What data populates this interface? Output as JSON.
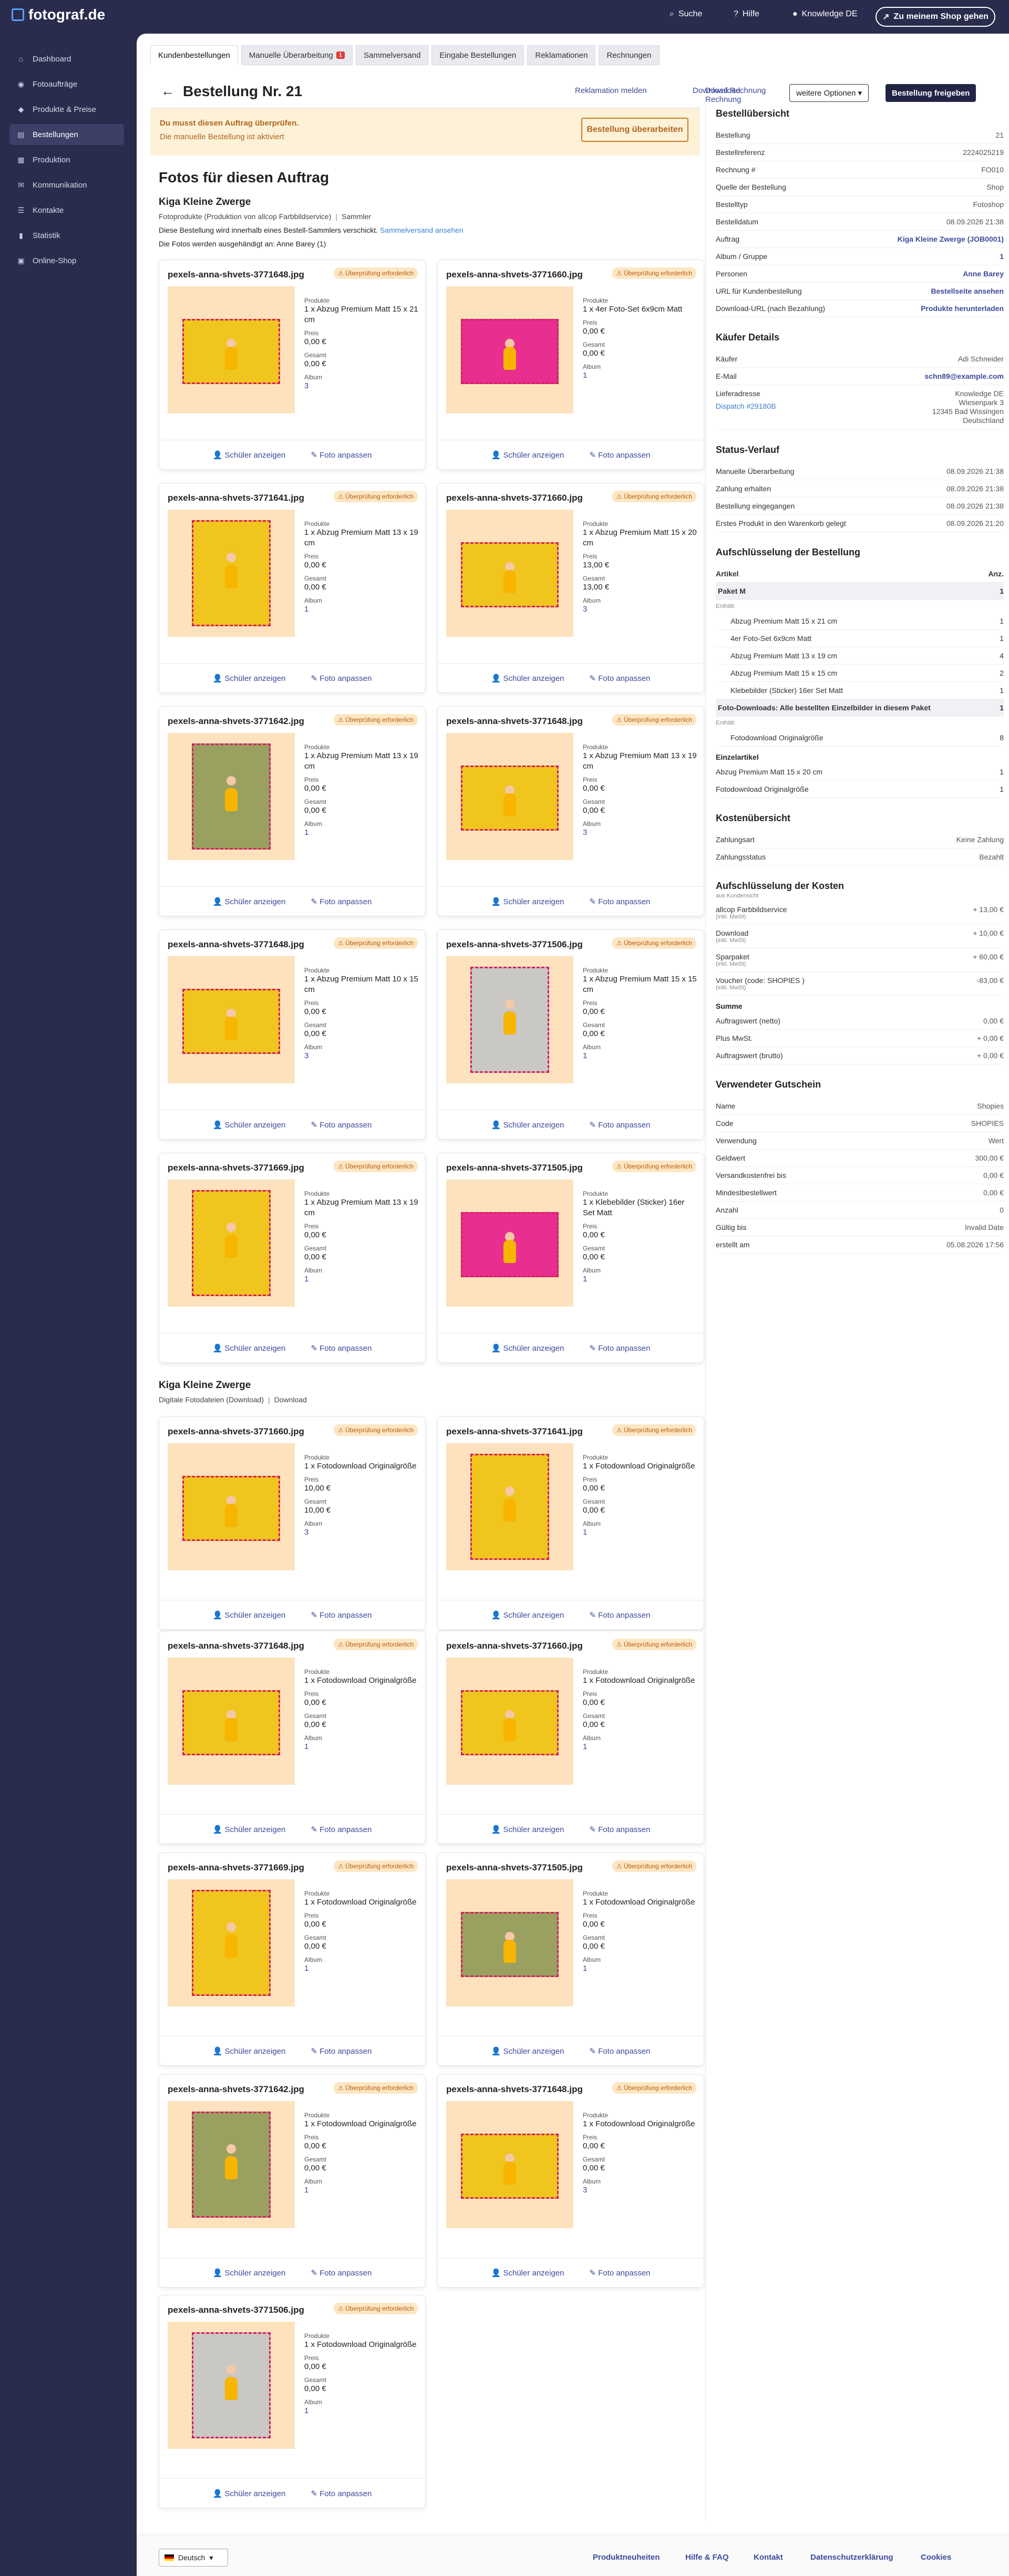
{
  "app": {
    "logo": "fotograf.de"
  },
  "sidebar": {
    "items": [
      {
        "label": "Dashboard",
        "icon": "home-icon",
        "glyph": "⌂"
      },
      {
        "label": "Fotoaufträge",
        "icon": "camera-icon",
        "glyph": "◉"
      },
      {
        "label": "Produkte & Preise",
        "icon": "tag-icon",
        "glyph": "◆"
      },
      {
        "label": "Bestellungen",
        "icon": "cart-icon",
        "glyph": "▤"
      },
      {
        "label": "Produktion",
        "icon": "factory-icon",
        "glyph": "▦"
      },
      {
        "label": "Kommunikation",
        "icon": "envelope-icon",
        "glyph": "✉"
      },
      {
        "label": "Kontakte",
        "icon": "contacts-icon",
        "glyph": "☰"
      },
      {
        "label": "Statistik",
        "icon": "chart-icon",
        "glyph": "▮"
      },
      {
        "label": "Online-Shop",
        "icon": "shop-icon",
        "glyph": "▣"
      }
    ]
  },
  "topbar": {
    "search": "Suche",
    "help": "Hilfe",
    "knowledge": "Knowledge DE",
    "shop_button": "Zu meinem Shop gehen"
  },
  "tabs": [
    {
      "label": "Kundenbestellungen"
    },
    {
      "label": "Manuelle Überarbeitung",
      "badge": "1"
    },
    {
      "label": "Sammelversand"
    },
    {
      "label": "Eingabe Bestellungen"
    },
    {
      "label": "Reklamationen"
    },
    {
      "label": "Rechnungen"
    }
  ],
  "header": {
    "title": "Bestellung Nr. 21",
    "reklamation": "Reklamation melden",
    "download": "Download Rechnung",
    "options": "weitere Optionen ▾",
    "release": "Bestellung freigeben"
  },
  "warning": {
    "title": "Du musst diesen Auftrag überprüfen.",
    "subtitle": "Die manuelle Bestellung ist aktiviert",
    "button": "Bestellung überarbeiten"
  },
  "main": {
    "section_title": "Fotos für diesen Auftrag",
    "group1": {
      "title": "Kiga Kleine Zwerge",
      "meta": "Fotoprodukte (Produktion von allcop Farbbildservice)",
      "meta2": "Sammler",
      "note": "Diese Bestellung wird innerhalb eines Bestell-Sammlers verschickt.",
      "note_link": "Sammelversand ansehen",
      "assigned": "Die Fotos werden ausgehändigt an: Anne Barey (1)"
    },
    "group2": {
      "title": "Kiga Kleine Zwerge",
      "meta": "Digitale Fotodateien (Download)",
      "meta2": "Download"
    }
  },
  "labels": {
    "produkte": "Produkte",
    "preis": "Preis",
    "gesamt": "Gesamt",
    "album": "Album",
    "badge": "⚠ Überprüfung erforderlich",
    "schueler": "Schüler anzeigen",
    "anpassen": "Foto anpassen"
  },
  "cards": [
    {
      "name": "pexels-anna-shvets-3771648.jpg",
      "product": "1 x Abzug Premium Matt 15 x 21 cm",
      "price": "0,00 €",
      "total": "0,00 €",
      "album": "3"
    },
    {
      "name": "pexels-anna-shvets-3771660.jpg",
      "product": "1 x 4er Foto-Set 6x9cm Matt",
      "price": "0,00 €",
      "total": "0,00 €",
      "album": "1"
    },
    {
      "name": "pexels-anna-shvets-3771641.jpg",
      "product": "1 x Abzug Premium Matt 13 x 19 cm",
      "price": "0,00 €",
      "total": "0,00 €",
      "album": "1"
    },
    {
      "name": "pexels-anna-shvets-3771660.jpg",
      "product": "1 x Abzug Premium Matt 15 x 20 cm",
      "price": "13,00 €",
      "total": "13,00 €",
      "album": "3"
    },
    {
      "name": "pexels-anna-shvets-3771642.jpg",
      "product": "1 x Abzug Premium Matt 13 x 19 cm",
      "price": "0,00 €",
      "total": "0,00 €",
      "album": "1"
    },
    {
      "name": "pexels-anna-shvets-3771648.jpg",
      "product": "1 x Abzug Premium Matt 13 x 19 cm",
      "price": "0,00 €",
      "total": "0,00 €",
      "album": "3"
    },
    {
      "name": "pexels-anna-shvets-3771648.jpg",
      "product": "1 x Abzug Premium Matt 10 x 15 cm",
      "price": "0,00 €",
      "total": "0,00 €",
      "album": "3"
    },
    {
      "name": "pexels-anna-shvets-3771506.jpg",
      "product": "1 x Abzug Premium Matt 15 x 15 cm",
      "price": "0,00 €",
      "total": "0,00 €",
      "album": "1"
    },
    {
      "name": "pexels-anna-shvets-3771669.jpg",
      "product": "1 x Abzug Premium Matt 13 x 19 cm",
      "price": "0,00 €",
      "total": "0,00 €",
      "album": "1"
    },
    {
      "name": "pexels-anna-shvets-3771505.jpg",
      "product": "1 x Klebebilder (Sticker) 16er Set Matt",
      "price": "0,00 €",
      "total": "0,00 €",
      "album": "1"
    },
    {
      "name": "pexels-anna-shvets-3771660.jpg",
      "product": "1 x Fotodownload Originalgröße",
      "price": "10,00 €",
      "total": "10,00 €",
      "album": "3"
    },
    {
      "name": "pexels-anna-shvets-3771641.jpg",
      "product": "1 x Fotodownload Originalgröße",
      "price": "0,00 €",
      "total": "0,00 €",
      "album": "1"
    },
    {
      "name": "pexels-anna-shvets-3771648.jpg",
      "product": "1 x Fotodownload Originalgröße",
      "price": "0,00 €",
      "total": "0,00 €",
      "album": "1"
    },
    {
      "name": "pexels-anna-shvets-3771660.jpg",
      "product": "1 x Fotodownload Originalgröße",
      "price": "0,00 €",
      "total": "0,00 €",
      "album": "1"
    },
    {
      "name": "pexels-anna-shvets-3771669.jpg",
      "product": "1 x Fotodownload Originalgröße",
      "price": "0,00 €",
      "total": "0,00 €",
      "album": "1"
    },
    {
      "name": "pexels-anna-shvets-3771505.jpg",
      "product": "1 x Fotodownload Originalgröße",
      "price": "0,00 €",
      "total": "0,00 €",
      "album": "1"
    },
    {
      "name": "pexels-anna-shvets-3771642.jpg",
      "product": "1 x Fotodownload Originalgröße",
      "price": "0,00 €",
      "total": "0,00 €",
      "album": "1"
    },
    {
      "name": "pexels-anna-shvets-3771648.jpg",
      "product": "1 x Fotodownload Originalgröße",
      "price": "0,00 €",
      "total": "0,00 €",
      "album": "3"
    },
    {
      "name": "pexels-anna-shvets-3771506.jpg",
      "product": "1 x Fotodownload Originalgröße",
      "price": "0,00 €",
      "total": "0,00 €",
      "album": "1"
    }
  ],
  "overview": {
    "title": "Bestellübersicht",
    "rows": [
      [
        "Bestellung",
        "21"
      ],
      [
        "Bestellreferenz",
        "2224025219"
      ],
      [
        "Rechnung #",
        "FO010"
      ],
      [
        "Quelle der Bestellung",
        "Shop"
      ],
      [
        "Bestelltyp",
        "Fotoshop"
      ],
      [
        "Bestelldatum",
        "08.09.2026 21:38"
      ],
      [
        "Auftrag",
        "Kiga Kleine Zwerge (JOB0001)"
      ],
      [
        "Album / Gruppe",
        "1"
      ],
      [
        "Personen",
        "Anne Barey"
      ],
      [
        "URL für Kundenbestellung",
        "Bestellseite ansehen"
      ],
      [
        "Download-URL (nach Bezahlung)",
        "Produkte herunterladen"
      ]
    ]
  },
  "buyer": {
    "title": "Käufer Details",
    "rows": [
      [
        "Käufer",
        "Adi Schneider"
      ],
      [
        "E-Mail",
        "schn89@example.com"
      ]
    ],
    "address_label": "Lieferadresse",
    "address": "Knowledge DE\nWiesenpark 3\n12345 Bad Wissingen\nDeutschland",
    "dispatch": "Dispatch #29180B"
  },
  "status": {
    "title": "Status-Verlauf",
    "rows": [
      [
        "Manuelle Überarbeitung",
        "08.09.2026 21:38"
      ],
      [
        "Zahlung erhalten",
        "08.09.2026 21:38"
      ],
      [
        "Bestellung eingegangen",
        "08.09.2026 21:38"
      ],
      [
        "Erstes Produkt in den Warenkorb gelegt",
        "08.09.2026 21:20"
      ]
    ]
  },
  "breakdown": {
    "title": "Aufschlüsselung der Bestellung",
    "head": [
      "Artikel",
      "Anz."
    ],
    "package": "Paket M",
    "package_qty": "1",
    "includes": "Enthält:",
    "items": [
      [
        "Abzug Premium Matt 15 x 21 cm",
        "1"
      ],
      [
        "4er Foto-Set 6x9cm Matt",
        "1"
      ],
      [
        "Abzug Premium Matt 13 x 19 cm",
        "4"
      ],
      [
        "Abzug Premium Matt 15 x 15 cm",
        "2"
      ],
      [
        "Klebebilder (Sticker) 16er Set Matt",
        "1"
      ]
    ],
    "downloads": "Foto-Downloads: Alle bestellten Einzelbilder in diesem Paket",
    "downloads_qty": "1",
    "dl_includes": "Enthält:",
    "dl_items": [
      [
        "Fotodownload Originalgröße",
        "8"
      ]
    ],
    "single": "Einzelartikel",
    "single_items": [
      [
        "Abzug Premium Matt 15 x 20 cm",
        "1"
      ],
      [
        "Fotodownload Originalgröße",
        "1"
      ]
    ]
  },
  "costs": {
    "title": "Kostenübersicht",
    "rows": [
      [
        "Zahlungsart",
        "Keine Zahlung"
      ],
      [
        "Zahlungsstatus",
        "Bezahlt"
      ]
    ]
  },
  "cost_breakdown": {
    "title": "Aufschlüsselung der Kosten",
    "sub": "aus Kundensicht",
    "rows": [
      [
        "allcop Farbbildservice",
        "(inkl. MwSt)",
        "+ 13,00 €"
      ],
      [
        "Download",
        "(inkl. MwSt)",
        "+ 10,00 €"
      ],
      [
        "Sparpaket",
        "(inkl. MwSt)",
        "+ 60,00 €"
      ],
      [
        "Voucher (code: SHOPIES )",
        "(inkl. MwSt)",
        "-83,00 €"
      ]
    ],
    "summe": "Summe",
    "sum_rows": [
      [
        "Auftragswert (netto)",
        "0,00 €"
      ],
      [
        "Plus MwSt.",
        "+ 0,00 €"
      ],
      [
        "Auftragswert (brutto)",
        "+ 0,00 €"
      ]
    ]
  },
  "voucher": {
    "title": "Verwendeter Gutschein",
    "rows": [
      [
        "Name",
        "Shopies"
      ],
      [
        "Code",
        "SHOPIES"
      ],
      [
        "Verwendung",
        "Wert"
      ],
      [
        "Geldwert",
        "300,00 €"
      ],
      [
        "Versandkostenfrei bis",
        "0,00 €"
      ],
      [
        "Mindestbestellwert",
        "0,00 €"
      ],
      [
        "Anzahl",
        "0"
      ],
      [
        "Gültig bis",
        "Invalid Date"
      ],
      [
        "erstellt am",
        "05.08.2026 17:56"
      ]
    ]
  },
  "footer": {
    "lang": "Deutsch",
    "links": [
      "Produktneuheiten",
      "Hilfe & FAQ",
      "Kontakt",
      "Datenschutzerklärung",
      "Cookies"
    ]
  }
}
